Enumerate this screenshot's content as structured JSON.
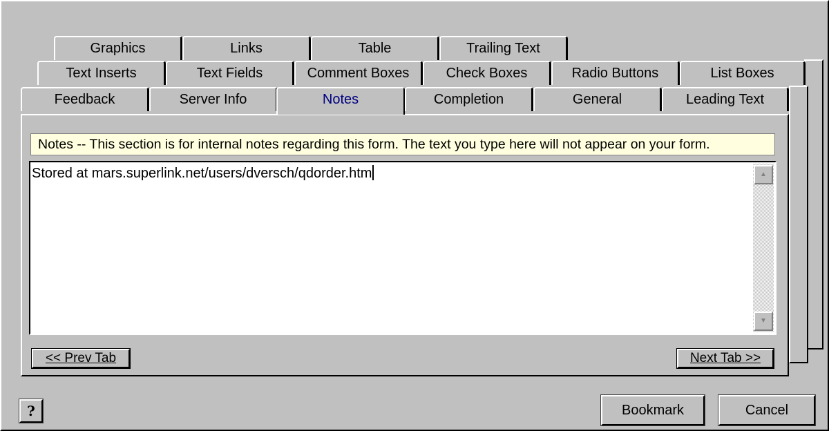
{
  "tabs": {
    "row1": [
      "Graphics",
      "Links",
      "Table",
      "Trailing Text"
    ],
    "row2": [
      "Text Inserts",
      "Text Fields",
      "Comment Boxes",
      "Check Boxes",
      "Radio Buttons",
      "List Boxes"
    ],
    "row3": [
      "Feedback",
      "Server Info",
      "Notes",
      "Completion",
      "General",
      "Leading Text"
    ],
    "active": "Notes"
  },
  "notice": "Notes -- This section is for internal notes regarding this form.  The text you type here will not appear on your form.",
  "notes_text": "Stored at mars.superlink.net/users/dversch/qdorder.htm",
  "prev_tab_label": "<< Prev Tab",
  "next_tab_label": "Next Tab >>",
  "help_label": "?",
  "bookmark_label": "Bookmark",
  "cancel_label": "Cancel",
  "icons": {
    "scroll_up": "scroll-up-arrow",
    "scroll_down": "scroll-down-arrow",
    "help": "question-mark-icon"
  }
}
